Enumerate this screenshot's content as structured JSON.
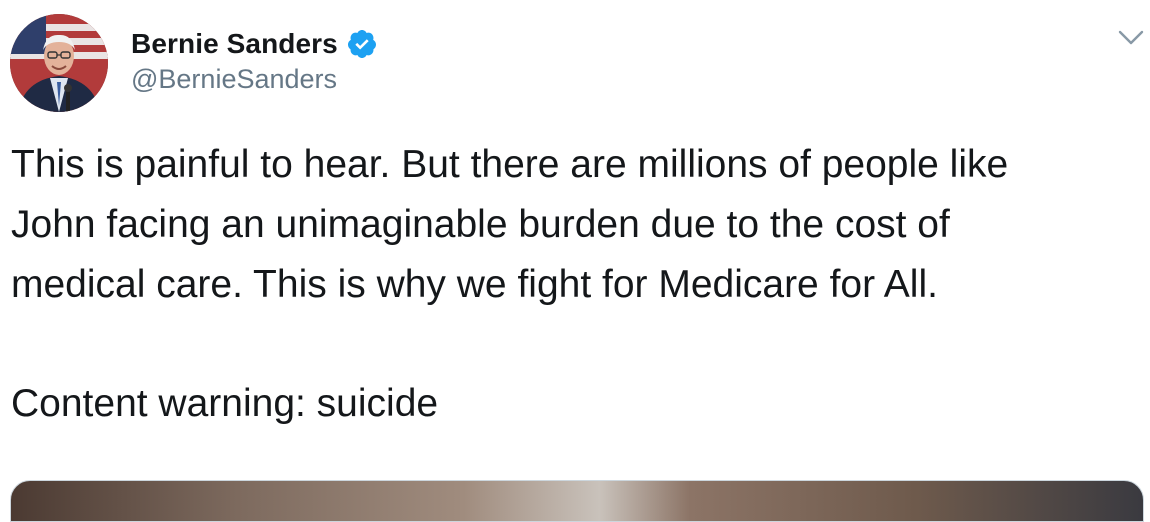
{
  "tweet": {
    "display_name": "Bernie Sanders",
    "handle": "@BernieSanders",
    "verified": true,
    "text_lines": [
      "This is painful to hear. But there are millions of people like",
      "John facing an unimaginable burden due to the cost of",
      "medical care. This is why we fight for Medicare for All."
    ],
    "warning": "Content warning: suicide"
  },
  "icons": {
    "verified": "verified-badge-icon",
    "menu": "chevron-down-icon"
  },
  "colors": {
    "text": "#14171a",
    "secondary": "#657786",
    "verified_blue": "#1da1f2"
  }
}
